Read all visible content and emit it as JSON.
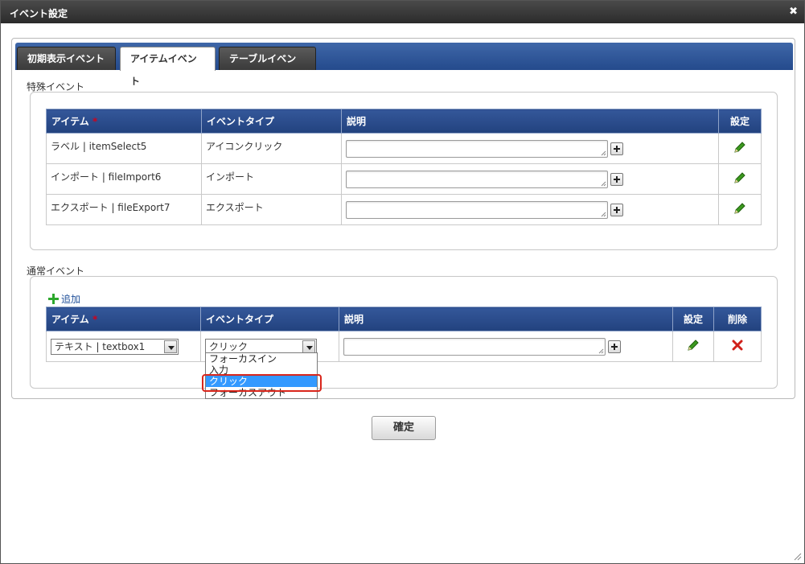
{
  "dialog": {
    "title": "イベント設定",
    "close_icon": "close-icon"
  },
  "tabs": [
    {
      "label": "初期表示イベント",
      "active": false
    },
    {
      "label": "アイテムイベント",
      "active": true
    },
    {
      "label": "テーブルイベント",
      "active": false
    }
  ],
  "special_events": {
    "label": "特殊イベント",
    "headers": {
      "item": "アイテム",
      "required_mark": "*",
      "event_type": "イベントタイプ",
      "description": "説明",
      "settings": "設定"
    },
    "rows": [
      {
        "item": "ラベル | itemSelect5",
        "event_type": "アイコンクリック",
        "description": ""
      },
      {
        "item": "インポート | fileImport6",
        "event_type": "インポート",
        "description": ""
      },
      {
        "item": "エクスポート | fileExport7",
        "event_type": "エクスポート",
        "description": ""
      }
    ]
  },
  "normal_events": {
    "label": "通常イベント",
    "add_label": "追加",
    "headers": {
      "item": "アイテム",
      "required_mark": "*",
      "event_type": "イベントタイプ",
      "description": "説明",
      "settings": "設定",
      "delete": "削除"
    },
    "rows": [
      {
        "item_select_value": "テキスト | textbox1",
        "event_type_value": "クリック",
        "description": ""
      }
    ],
    "event_type_options": [
      "フォーカスイン",
      "入力",
      "クリック",
      "フォーカスアウト"
    ],
    "selected_option": "クリック"
  },
  "footer": {
    "confirm_label": "確定"
  },
  "colors": {
    "header_blue": "#22427e",
    "tabbar_blue": "#3f67a8",
    "highlight_red": "#d9261c",
    "selected_option": "#3399ff"
  }
}
